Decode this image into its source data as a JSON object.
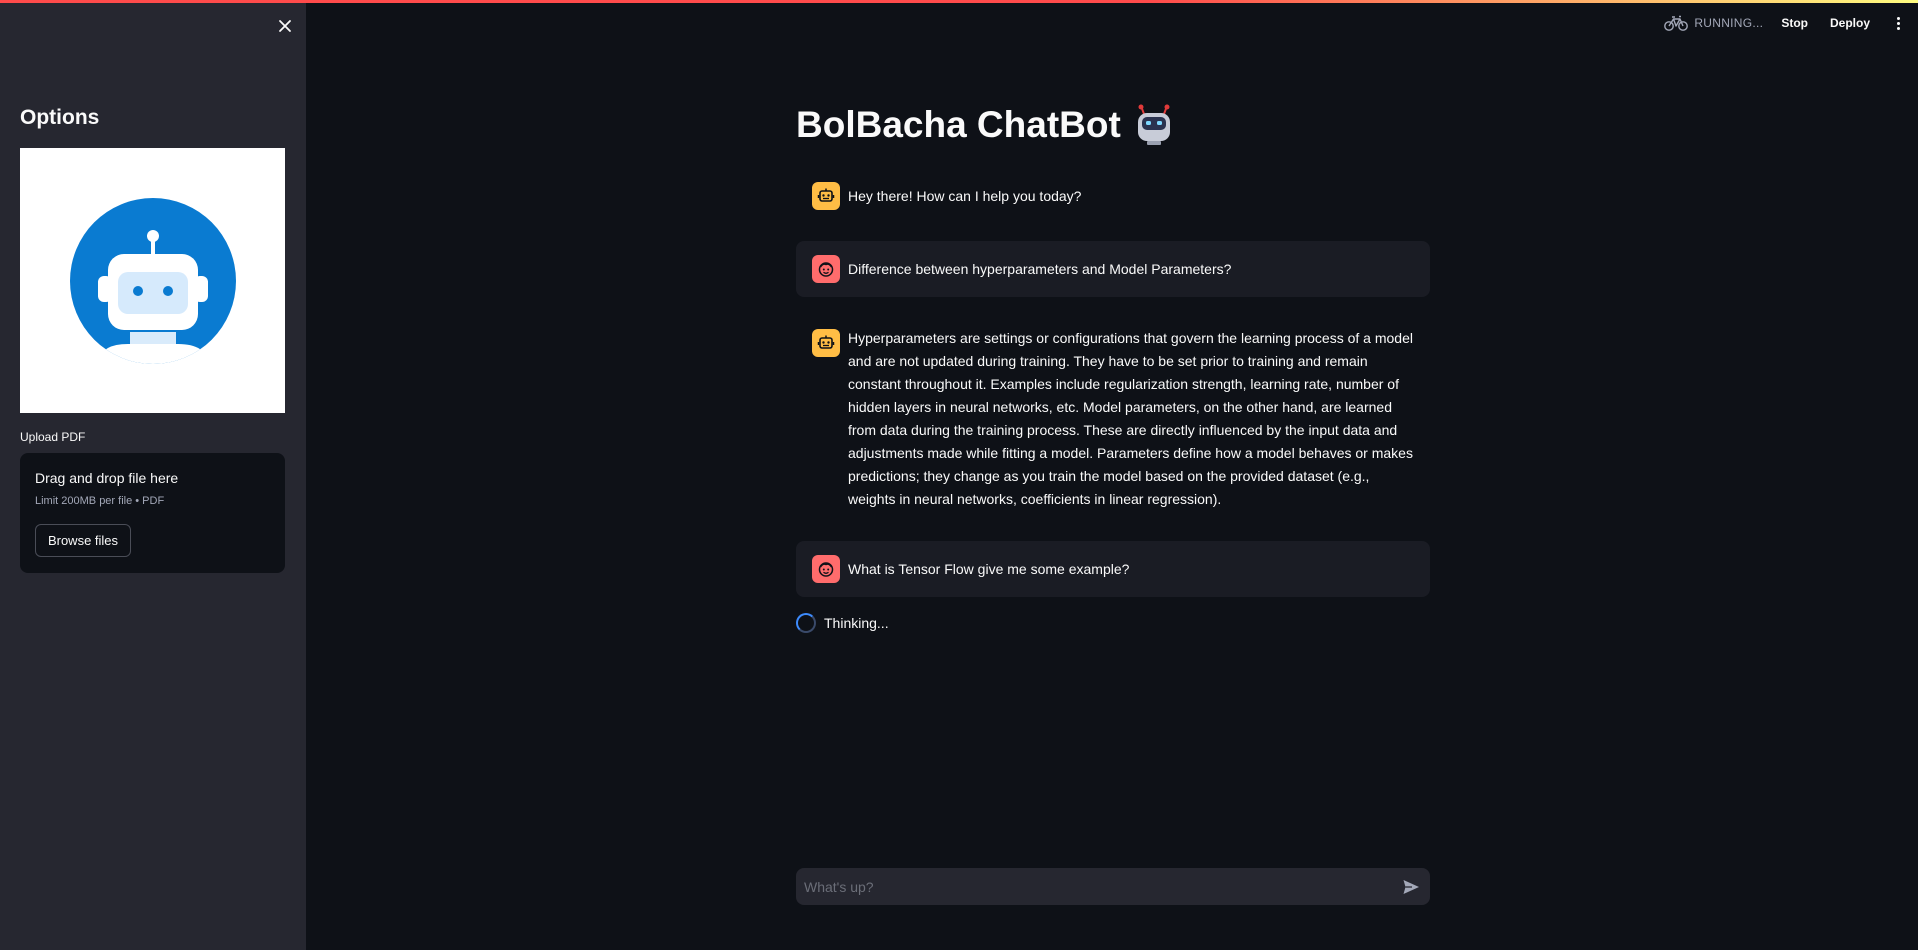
{
  "header": {
    "status_text": "RUNNING...",
    "stop_label": "Stop",
    "deploy_label": "Deploy"
  },
  "sidebar": {
    "title": "Options",
    "upload_label": "Upload PDF",
    "dropzone_title": "Drag and drop file here",
    "dropzone_limit": "Limit 200MB per file • PDF",
    "browse_label": "Browse files"
  },
  "main": {
    "title": "BolBacha ChatBot",
    "messages": [
      {
        "role": "assistant",
        "text": "Hey there! How can I help you today?"
      },
      {
        "role": "user",
        "text": "Difference between hyperparameters and Model Parameters?"
      },
      {
        "role": "assistant",
        "text": "Hyperparameters are settings or configurations that govern the learning process of a model and are not updated during training. They have to be set prior to training and remain constant throughout it. Examples include regularization strength, learning rate, number of hidden layers in neural networks, etc. Model parameters, on the other hand, are learned from data during the training process. These are directly influenced by the input data and adjustments made while fitting a model. Parameters define how a model behaves or makes predictions; they change as you train the model based on the provided dataset (e.g., weights in neural networks, coefficients in linear regression)."
      },
      {
        "role": "user",
        "text": "What is Tensor Flow give me some example?"
      }
    ],
    "thinking_text": "Thinking..."
  },
  "chat_input": {
    "placeholder": "What's up?"
  },
  "colors": {
    "background": "#0e1117",
    "sidebar": "#262730",
    "assistant_avatar": "#ffbd45",
    "user_avatar": "#ff6c6c",
    "logo_blue": "#0a7bd1"
  }
}
